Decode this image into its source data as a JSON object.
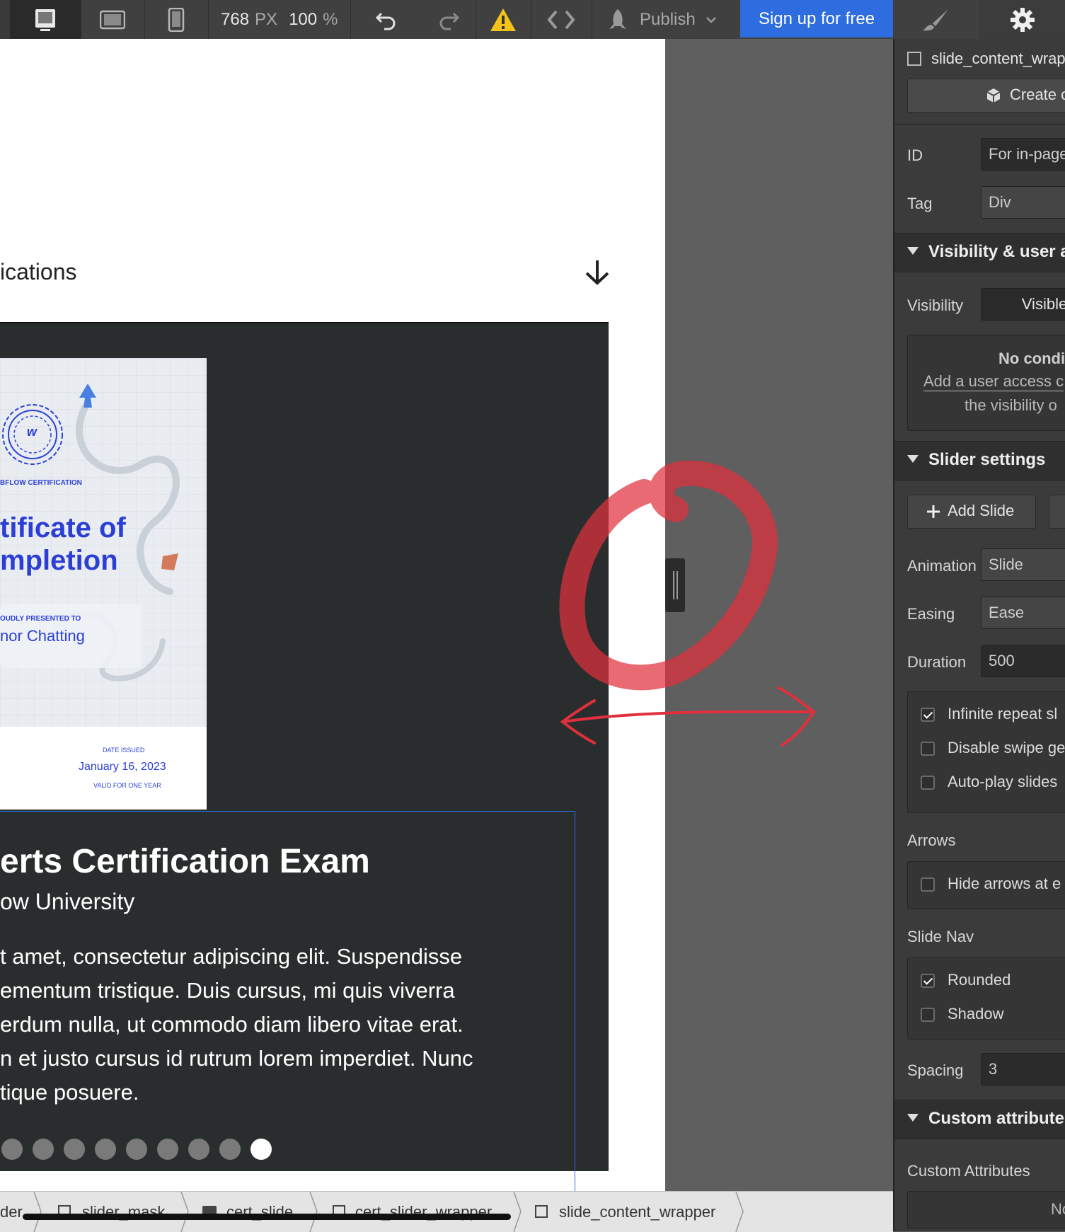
{
  "toolbar": {
    "width_value": "768",
    "width_unit": "PX",
    "zoom_value": "100",
    "zoom_unit": "%",
    "publish_label": "Publish",
    "signup_label": "Sign up for free"
  },
  "canvas": {
    "section_title": "ications",
    "certificate": {
      "header": "BFLOW CERTIFICATION",
      "title_line1": "tificate of",
      "title_line2": "mpletion",
      "presented_label": "OUDLY PRESENTED TO",
      "recipient": "nor Chatting",
      "date_label": "DATE ISSUED",
      "date": "January 16, 2023",
      "validity": "VALID FOR ONE YEAR",
      "seal_letter": "w"
    },
    "exam_title": "erts Certification Exam",
    "exam_subtitle": "ow University",
    "paragraph_lines": [
      "t amet, consectetur adipiscing elit. Suspendisse",
      "ementum tristique. Duis cursus, mi quis viverra",
      "erdum nulla, ut commodo diam libero vitae erat.",
      "n et justo cursus id rutrum lorem imperdiet. Nunc",
      "tique posuere."
    ],
    "slide_dots": 9,
    "active_dot": 9
  },
  "breadcrumb": {
    "items": [
      "der",
      "slider_mask",
      "cert_slide",
      "cert_slider_wrapper",
      "slide_content_wrapper"
    ]
  },
  "panel": {
    "element_name": "slide_content_wrap",
    "create_label": "Create c",
    "id_label": "ID",
    "id_placeholder": "For in-page",
    "tag_label": "Tag",
    "tag_value": "Div",
    "visibility_section": "Visibility & user a",
    "visibility_label": "Visibility",
    "visibility_value": "Visible",
    "no_conditions_title": "No condi",
    "no_conditions_line1": "Add a user access c",
    "no_conditions_line2": "the visibility o",
    "slider_section": "Slider settings",
    "add_slide_label": "Add Slide",
    "animation_label": "Animation",
    "animation_value": "Slide",
    "easing_label": "Easing",
    "easing_value": "Ease",
    "duration_label": "Duration",
    "duration_value": "500",
    "options": [
      {
        "label": "Infinite repeat sl",
        "checked": true
      },
      {
        "label": "Disable swipe ge",
        "checked": false
      },
      {
        "label": "Auto-play slides",
        "checked": false
      }
    ],
    "arrows_label": "Arrows",
    "hide_arrows_label": "Hide arrows at e",
    "slide_nav_label": "Slide Nav",
    "nav_options": [
      {
        "label": "Rounded",
        "checked": true
      },
      {
        "label": "Shadow",
        "checked": false
      }
    ],
    "spacing_label": "Spacing",
    "spacing_value": "3",
    "custom_section": "Custom attribute",
    "custom_attributes_label": "Custom Attributes",
    "custom_attributes_empty": "No"
  },
  "colors": {
    "accent": "#2d6ddf",
    "annotation": "#e0303c",
    "warning": "#f5c21b"
  }
}
